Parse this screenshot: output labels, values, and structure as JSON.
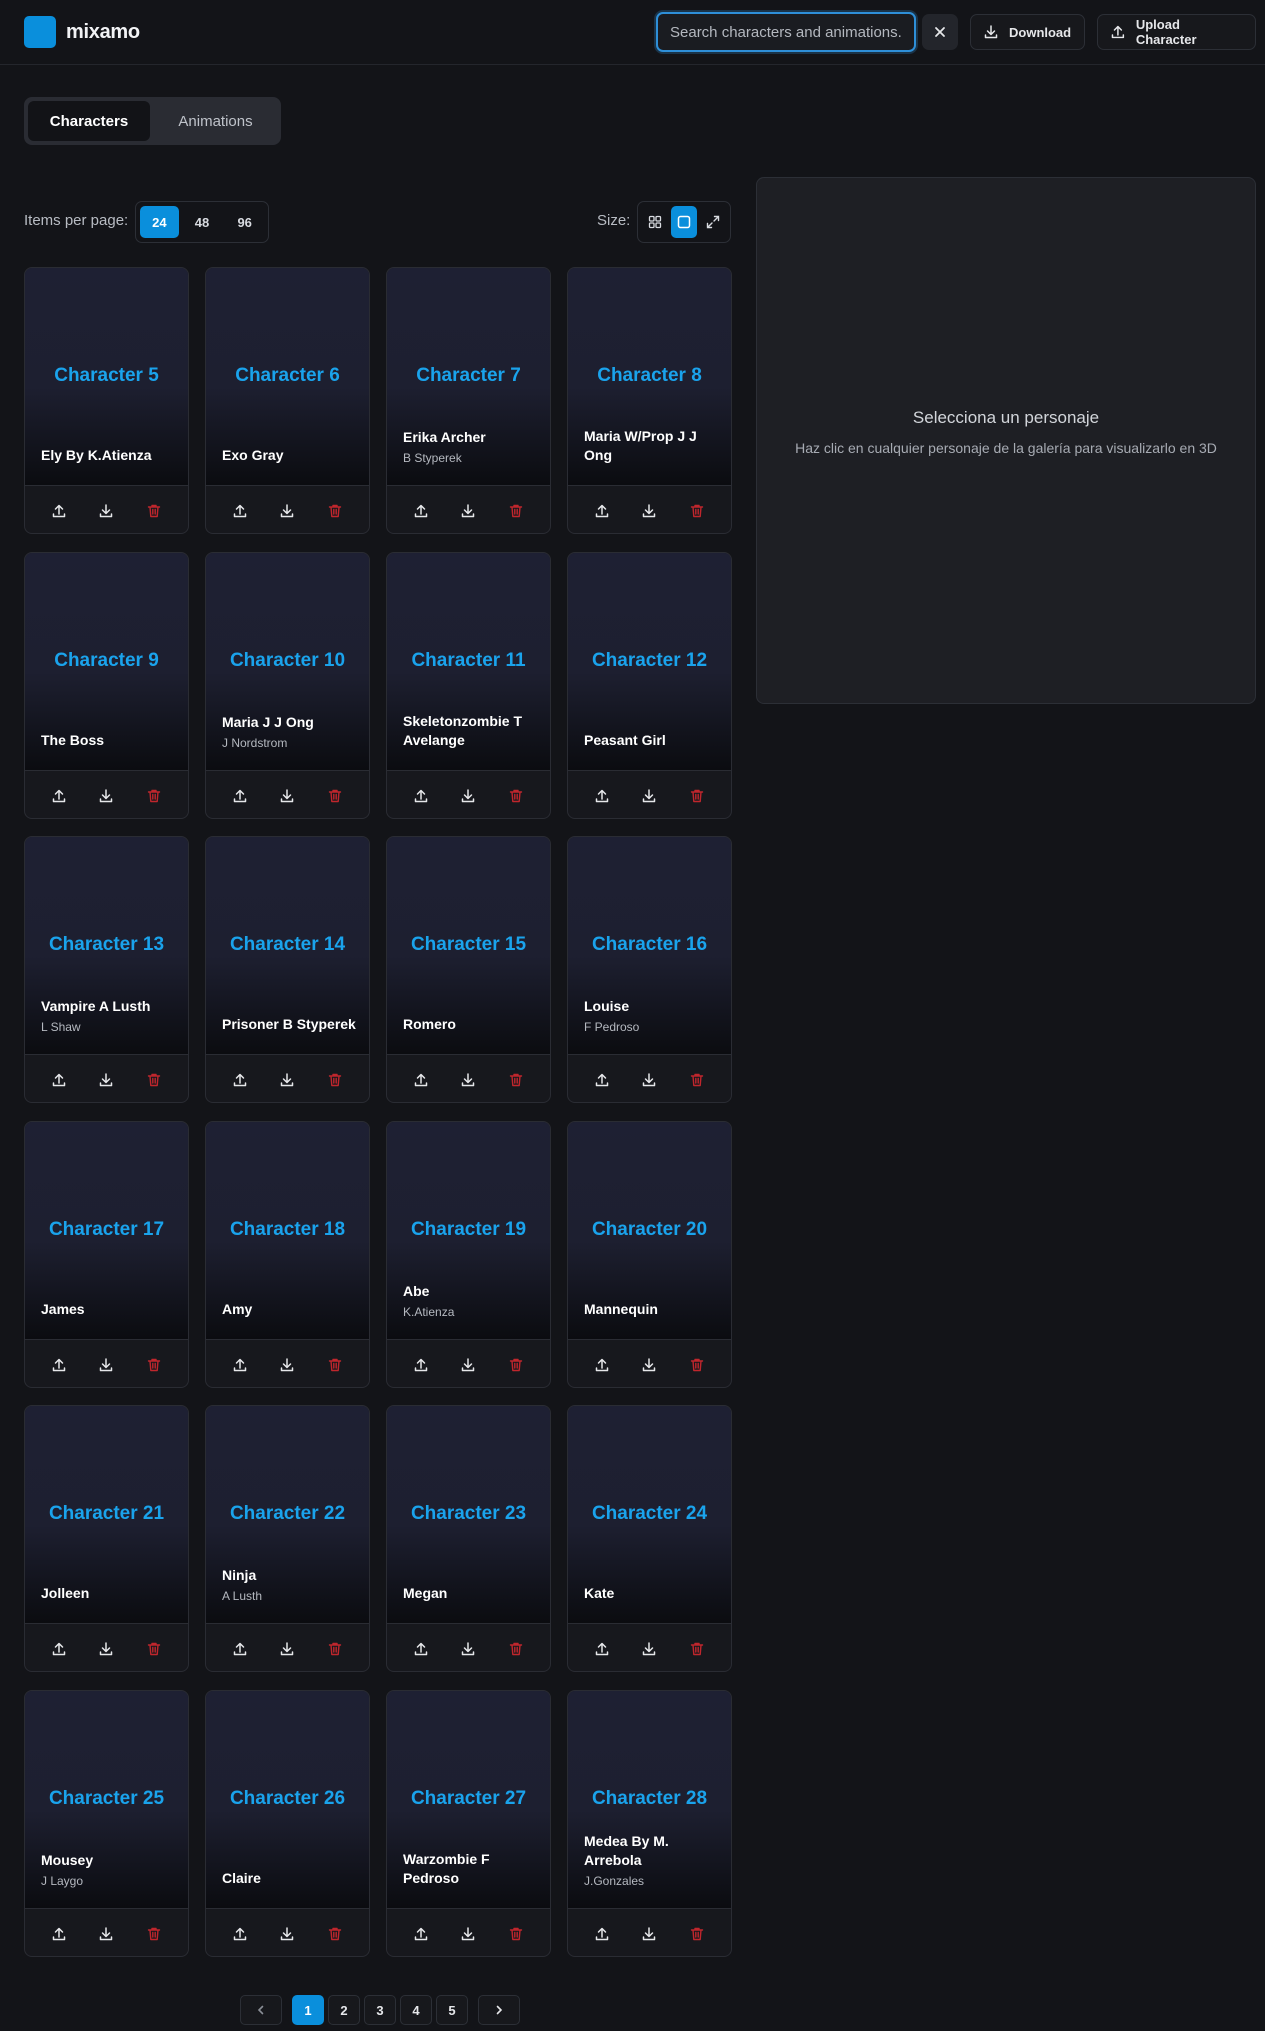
{
  "header": {
    "logo_text": "mixamo",
    "search_placeholder": "Search characters and animations...",
    "download_label": "Download",
    "upload_label": "Upload Character"
  },
  "tabs": [
    {
      "label": "Characters",
      "active": true
    },
    {
      "label": "Animations",
      "active": false
    }
  ],
  "items_per_page": {
    "label": "Items per page:",
    "options": [
      "24",
      "48",
      "96"
    ],
    "selected": "24"
  },
  "size": {
    "label": "Size:",
    "options": [
      "grid-small-icon",
      "square-icon",
      "expand-icon"
    ],
    "selected": "square-icon"
  },
  "characters": [
    {
      "title": "Character 5",
      "name": "Ely By K.Atienza",
      "author": ""
    },
    {
      "title": "Character 6",
      "name": "Exo Gray",
      "author": ""
    },
    {
      "title": "Character 7",
      "name": "Erika Archer",
      "author": "B Styperek"
    },
    {
      "title": "Character 8",
      "name": "Maria W/Prop J J Ong",
      "author": ""
    },
    {
      "title": "Character 9",
      "name": "The Boss",
      "author": ""
    },
    {
      "title": "Character 10",
      "name": "Maria J J Ong",
      "author": "J Nordstrom"
    },
    {
      "title": "Character 11",
      "name": "Skeletonzombie T Avelange",
      "author": ""
    },
    {
      "title": "Character 12",
      "name": "Peasant Girl",
      "author": ""
    },
    {
      "title": "Character 13",
      "name": "Vampire A Lusth",
      "author": "L Shaw"
    },
    {
      "title": "Character 14",
      "name": "Prisoner B Styperek",
      "author": ""
    },
    {
      "title": "Character 15",
      "name": "Romero",
      "author": ""
    },
    {
      "title": "Character 16",
      "name": "Louise",
      "author": "F Pedroso"
    },
    {
      "title": "Character 17",
      "name": "James",
      "author": ""
    },
    {
      "title": "Character 18",
      "name": "Amy",
      "author": ""
    },
    {
      "title": "Character 19",
      "name": "Abe",
      "author": "K.Atienza"
    },
    {
      "title": "Character 20",
      "name": "Mannequin",
      "author": ""
    },
    {
      "title": "Character 21",
      "name": "Jolleen",
      "author": ""
    },
    {
      "title": "Character 22",
      "name": "Ninja",
      "author": "A Lusth"
    },
    {
      "title": "Character 23",
      "name": "Megan",
      "author": ""
    },
    {
      "title": "Character 24",
      "name": "Kate",
      "author": ""
    },
    {
      "title": "Character 25",
      "name": "Mousey",
      "author": "J Laygo"
    },
    {
      "title": "Character 26",
      "name": "Claire",
      "author": ""
    },
    {
      "title": "Character 27",
      "name": "Warzombie F Pedroso",
      "author": ""
    },
    {
      "title": "Character 28",
      "name": "Medea By M. Arrebola",
      "author": "J.Gonzales"
    }
  ],
  "viewer": {
    "title": "Selecciona un personaje",
    "subtitle": "Haz clic en cualquier personaje de la galería para visualizarlo en 3D"
  },
  "pagination": {
    "pages": [
      "1",
      "2",
      "3",
      "4",
      "5"
    ],
    "current": "1"
  },
  "colors": {
    "accent": "#0a8fdc",
    "title_blue": "#1aa3ec",
    "delete_red": "#c0262d",
    "background": "#131418"
  }
}
